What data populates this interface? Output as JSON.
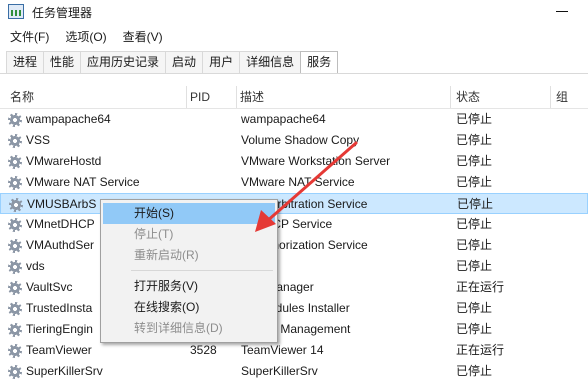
{
  "window": {
    "title": "任务管理器"
  },
  "menu": [
    "文件(F)",
    "选项(O)",
    "查看(V)"
  ],
  "tabs": [
    "进程",
    "性能",
    "应用历史记录",
    "启动",
    "用户",
    "详细信息",
    "服务"
  ],
  "active_tab": "服务",
  "columns": {
    "name": "名称",
    "pid": "PID",
    "description": "描述",
    "status": "状态",
    "group": "组"
  },
  "services": [
    {
      "name": "wampapache64",
      "pid": "",
      "description": "wampapache64",
      "status": "已停止"
    },
    {
      "name": "VSS",
      "pid": "",
      "description": "Volume Shadow Copy",
      "status": "已停止"
    },
    {
      "name": "VMwareHostd",
      "pid": "",
      "description": "VMware Workstation Server",
      "status": "已停止"
    },
    {
      "name": "VMware NAT Service",
      "pid": "",
      "description": "VMware NAT Service",
      "status": "已停止"
    },
    {
      "name": "VMUSBArbS",
      "pid": "",
      "description": "USB Arbitration Service",
      "status": "已停止"
    },
    {
      "name": "VMnetDHCP",
      "pid": "",
      "description": "re DHCP Service",
      "status": "已停止"
    },
    {
      "name": "VMAuthdSer",
      "pid": "",
      "description": "re Authorization Service",
      "status": "已停止"
    },
    {
      "name": "vds",
      "pid": "",
      "description": "Disk",
      "status": "已停止"
    },
    {
      "name": "VaultSvc",
      "pid": "",
      "description": "ntial Manager",
      "status": "正在运行"
    },
    {
      "name": "TrustedInsta",
      "pid": "",
      "description": "ws Modules Installer",
      "status": "已停止"
    },
    {
      "name": "TieringEngin",
      "pid": "",
      "description": "e Tiers Management",
      "status": "已停止"
    },
    {
      "name": "TeamViewer",
      "pid": "3528",
      "description": "TeamViewer 14",
      "status": "正在运行"
    },
    {
      "name": "SuperKillerSrv",
      "pid": "",
      "description": "SuperKillerSrv",
      "status": "已停止"
    }
  ],
  "context_menu": {
    "start": "开始(S)",
    "stop": "停止(T)",
    "restart": "重新启动(R)",
    "open_services": "打开服务(V)",
    "search_online": "在线搜索(O)",
    "go_to_details": "转到详细信息(D)"
  },
  "colors": {
    "selection": "#cce8ff",
    "menu_hover": "#91c9f7",
    "arrow": "#e53935"
  }
}
